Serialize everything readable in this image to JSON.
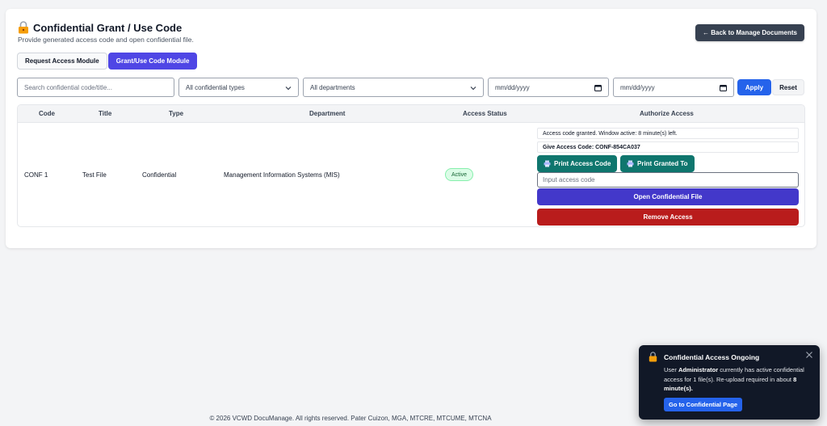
{
  "header": {
    "title": "Confidential Grant / Use Code",
    "subtitle": "Provide generated access code and open confidential file.",
    "back_button": "← Back to Manage Documents"
  },
  "tabs": [
    {
      "label": "Request Access Module",
      "active": false
    },
    {
      "label": "Grant/Use Code Module",
      "active": true
    }
  ],
  "filters": {
    "search_placeholder": "Search confidential code/title...",
    "type_select": "All confidential types",
    "department_select": "All departments",
    "date_from": "mm/dd/yyyy",
    "date_to": "mm/dd/yyyy",
    "apply_label": "Apply",
    "reset_label": "Reset"
  },
  "table": {
    "columns": [
      "Code",
      "Title",
      "Type",
      "Department",
      "Access Status",
      "Authorize Access"
    ],
    "rows": [
      {
        "code": "CONF 1",
        "title": "Test File",
        "type": "Confidential",
        "department": "Management Information Systems (MIS)",
        "status": "Active",
        "auth": {
          "granted_text": "Access code granted. Window active: 8 minute(s) left.",
          "code_label": "Give Access Code:",
          "code_value": "CONF-854CA037",
          "print_code_label": "Print Access Code",
          "print_granted_label": "Print Granted To",
          "code_input_placeholder": "Input access code",
          "open_label": "Open Confidential File",
          "remove_label": "Remove Access"
        }
      }
    ]
  },
  "footer": "© 2026 VCWD DocuManage. All rights reserved. Pater Cuizon, MGA, MTCRE, MTCUME, MTCNA",
  "toast": {
    "title": "Confidential Access Ongoing",
    "body_prefix": "User",
    "user": "Administrator",
    "body_suffix": "currently has active confidential access for 1 file(s). Re-upload required in about",
    "minutes": "8 minute(s).",
    "button": "Go to Confidential Page"
  },
  "colors": {
    "primary": "#4f46e5",
    "apply": "#2563eb",
    "teal": "#0f766e",
    "danger": "#b91c1c",
    "dark": "#374151"
  }
}
